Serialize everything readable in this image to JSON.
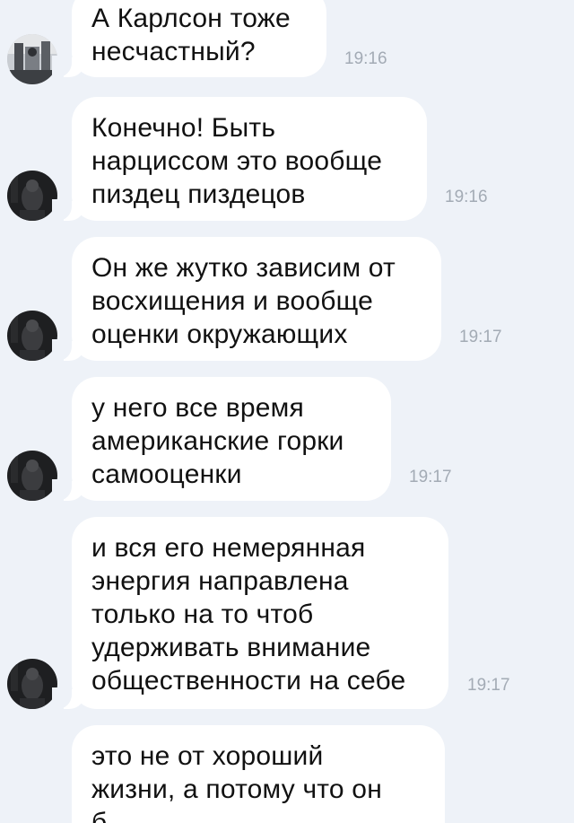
{
  "messages": [
    {
      "lines": [
        "А Карлсон тоже",
        "несчастный?"
      ],
      "time": "19:16",
      "avatar": "contact-avatar-photo"
    },
    {
      "lines": [
        "Конечно! Быть",
        "нарциссом это вообще",
        "пиздец пиздецов"
      ],
      "time": "19:16",
      "avatar": "user-avatar-photo"
    },
    {
      "lines": [
        "Он же жутко зависим от",
        "восхищения и вообще",
        "оценки окружающих"
      ],
      "time": "19:17",
      "avatar": "user-avatar-photo"
    },
    {
      "lines": [
        "у него все время",
        "американские горки",
        "самооценки"
      ],
      "time": "19:17",
      "avatar": "user-avatar-photo"
    },
    {
      "lines": [
        "и вся его немерянная",
        "энергия направлена",
        "только на то чтоб",
        "удерживать внимание",
        "общественности на себе"
      ],
      "time": "19:17",
      "avatar": "user-avatar-photo"
    },
    {
      "lines": [
        "это не от хороший",
        "жизни, а потому что он",
        "б"
      ],
      "time": "",
      "avatar": ""
    }
  ],
  "colors": {
    "background": "#eef2f8",
    "bubble": "#ffffff",
    "text": "#111111",
    "timestamp": "#a3abb5"
  }
}
